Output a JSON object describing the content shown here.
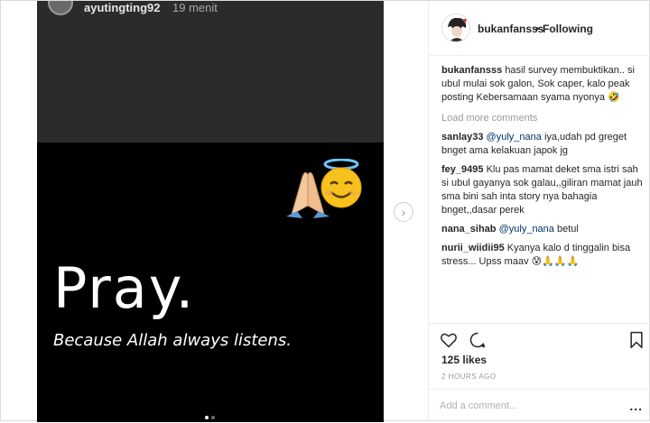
{
  "story": {
    "username": "ayutingting92",
    "time": "19 menit",
    "headline": "Pray.",
    "subline": "Because Allah always listens."
  },
  "post": {
    "username": "bukanfansss",
    "separator": "•",
    "follow_status": "Following",
    "caption_user": "bukanfansss",
    "caption_text": "hasil survey membuktikan.. si ubul mulai sok galon, Sok caper, kalo peak posting Kebersamaan syama nyonya 🤣",
    "load_more": "Load more comments",
    "comments": [
      {
        "user": "sanlay33",
        "mention": "@yuly_nana",
        "text": "iya,udah pd greget bnget ama kelakuan japok jg"
      },
      {
        "user": "fey_9495",
        "mention": "",
        "text": "Klu pas mamat deket sma istri sah si ubul gayanya sok galau,,giliran mamat jauh sma bini sah inta story nya bahagia bnget,,dasar perek"
      },
      {
        "user": "nana_sihab",
        "mention": "@yuly_nana",
        "text": "betul"
      },
      {
        "user": "nurii_wiidii95",
        "mention": "",
        "text": "Kyanya kalo d tinggalin bisa stress... Upss maav 😰🙏🙏🙏"
      }
    ],
    "likes": "125 likes",
    "ago": "2 HOURS AGO",
    "add_comment_placeholder": "Add a comment...",
    "more_options": "..."
  },
  "nav": {
    "next": "›"
  },
  "icons": {
    "heart": "heart-icon",
    "comment": "comment-icon",
    "bookmark": "bookmark-icon",
    "pray_hands": "folded-hands-icon",
    "halo_face": "smiling-face-with-halo-icon"
  }
}
